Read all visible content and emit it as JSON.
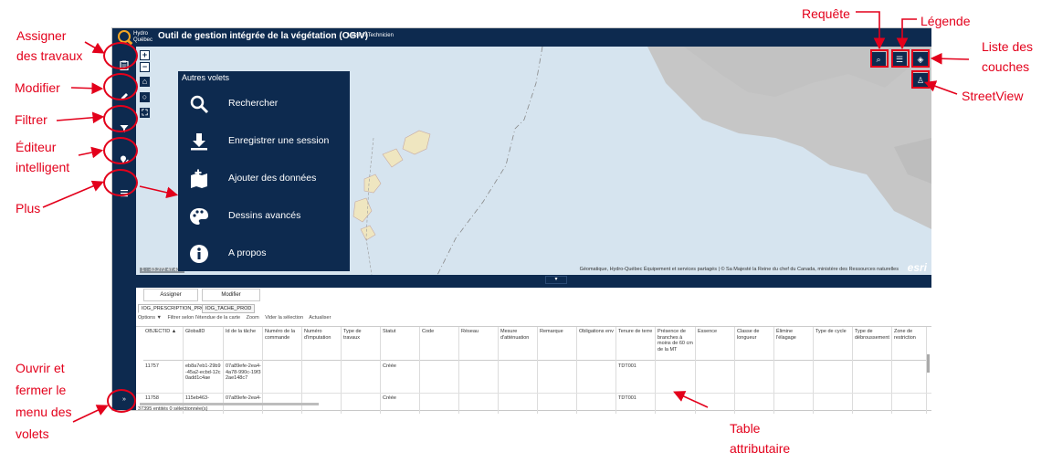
{
  "app": {
    "logo_text_1": "Hydro",
    "logo_text_2": "Québec",
    "title": "Outil de gestion intégrée de la végétation (OGIV)",
    "version": "Version Technicien"
  },
  "callouts": {
    "assigner": [
      "Assigner",
      "des travaux"
    ],
    "modifier": "Modifier",
    "filtrer": "Filtrer",
    "editeur": [
      "Éditeur",
      "intelligent"
    ],
    "plus": "Plus",
    "ouvrir": [
      "Ouvrir et",
      "fermer le",
      "menu des",
      "volets"
    ],
    "requete": "Requête",
    "legende": "Légende",
    "liste": [
      "Liste des",
      "couches"
    ],
    "streetview": "StreetView",
    "table": [
      "Table",
      "attributaire"
    ]
  },
  "sidebar": {
    "assign_icon": "clipboard-icon",
    "edit_icon": "pencil-icon",
    "filter_icon": "funnel-icon",
    "smart_editor_icon": "marker-edit-icon",
    "more_icon": "menu-icon",
    "expand_label": "»"
  },
  "map": {
    "zoom_in": "+",
    "zoom_out": "−",
    "scale_text": "1 : -63.272 47.432",
    "attribution": "Géomatique, Hydro-Québec Équipement et services partagés | © Sa Majesté la Reine du chef du Canada, ministère des Ressources naturelles",
    "esri": "esri",
    "colors": {
      "water": "#d6e4ef",
      "land": "#c6c6c6",
      "island": "#efe6c0"
    }
  },
  "volets": {
    "title": "Autres volets",
    "items": [
      {
        "label": "Rechercher",
        "icon": "search-icon"
      },
      {
        "label": "Enregistrer une session",
        "icon": "download-icon"
      },
      {
        "label": "Ajouter des données",
        "icon": "add-data-icon"
      },
      {
        "label": "Dessins avancés",
        "icon": "palette-icon"
      },
      {
        "label": "A propos",
        "icon": "info-icon"
      }
    ]
  },
  "bottom": {
    "assigner": "Assigner",
    "modifier": "Modifier",
    "tabs": [
      "IOG_PRESCRIPTION_PROD",
      "IOG_TACHE_PROD"
    ],
    "toolbar": [
      "Options ▼",
      "Filtrer selon l'étendue de la carte",
      "Zoom",
      "Vider la sélection",
      "Actualiser"
    ],
    "columns": [
      "OBJECTID ▲",
      "GlobalID",
      "Id de la tâche",
      "Numéro de la commande",
      "Numéro d'imputation",
      "Type de travaux",
      "Statut",
      "Code",
      "Réseau",
      "Mesure d'atténuation",
      "Remarque",
      "Obligations env",
      "Tenure de terre",
      "Présence de branches à moins de 60 cm de la MT",
      "Essence",
      "Classe de longueur",
      "Élimine l'élagage",
      "Type de cycle",
      "Type de débroussement",
      "Zone de restriction"
    ],
    "rows": [
      {
        "objectid": "11757",
        "globalid": "eb8a7eb1-29b9-45a2-ecbd-12c0add1c4ae",
        "tache": "07a89efe-2ea4-4a78-990c-19f32ae148c7",
        "statut": "Créée",
        "tenure": "TDT001"
      },
      {
        "objectid": "11758",
        "globalid": "115eb463-",
        "tache": "07a89efe-2ea4-",
        "statut": "Créée",
        "tenure": "TDT001"
      }
    ],
    "footer": "37395 entités 0 sélectionnée(s)"
  }
}
